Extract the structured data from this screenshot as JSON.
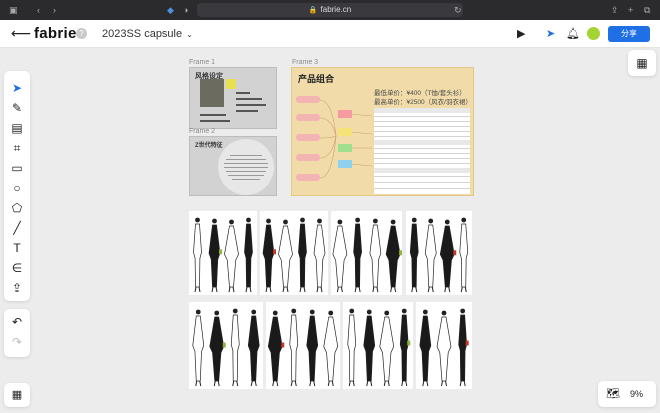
{
  "browser": {
    "url": "fabrie.cn"
  },
  "header": {
    "logo": "fabrie",
    "project_title": "2023SS capsule",
    "share_label": "分享"
  },
  "canvas": {
    "frames": [
      {
        "label": "Frame 1",
        "title": "风格设定"
      },
      {
        "label": "Frame 2",
        "title": "Z世代特征"
      },
      {
        "label": "Frame 3",
        "title": "产品组合",
        "price_low": "最低单价：¥400（T恤/套头衫）",
        "price_high": "最高单价：¥2500（风衣/羽衣裙）"
      }
    ]
  },
  "zoom": {
    "level": "9%"
  },
  "icons": {
    "toolbar": [
      "pointer-icon",
      "pen-icon",
      "frame-icon",
      "crop-icon",
      "sticky-note-icon",
      "circle-icon",
      "pentagon-icon",
      "line-icon",
      "text-icon",
      "connector-icon",
      "upload-icon"
    ],
    "history": [
      "undo-icon",
      "redo-icon"
    ]
  },
  "colors": {
    "accent": "#1f6fe5",
    "avatar": "#a6d334",
    "frame3_bg": "#f1dca9"
  }
}
